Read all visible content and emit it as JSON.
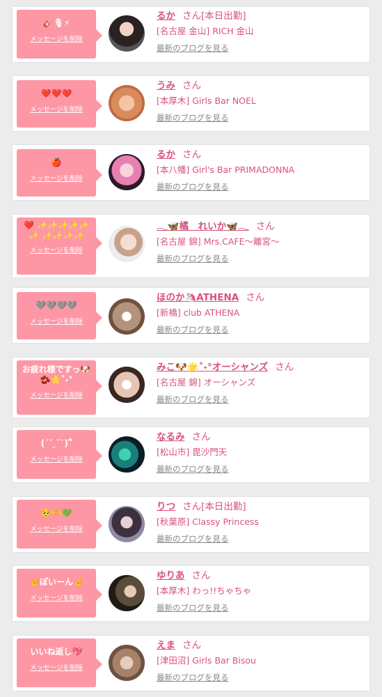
{
  "delete_label": "メッセージを削除",
  "blog_label": "最新のブログを見る",
  "honorific": "さん",
  "colors": {
    "background": "#ececec",
    "bubble": "#fe97a5",
    "accent": "#d8527b",
    "muted": "#888888"
  },
  "items": [
    {
      "message": "🎸🎙⚡",
      "name": "るか",
      "status": "[本日出勤]",
      "shop": "[名古屋 金山] RICH 金山"
    },
    {
      "message": "❤️❤️❤️",
      "name": "うみ",
      "status": "",
      "shop": "[本厚木] Girls Bar NOEL"
    },
    {
      "message": "🍎",
      "name": "るか",
      "status": "",
      "shop": "[本八幡] Girl's Bar PRIMADONNA"
    },
    {
      "message": "❤️ ✨✨✨✨✨✨ ✨✨✨✨",
      "name": "𓂃🦋橘　れいか🦋𓂃",
      "status": "",
      "shop": "[名古屋 錦] Mrs.CAFE〜離宮〜"
    },
    {
      "message": "🩶🩶🩶🩶",
      "name": "ほのか🦄ATHENA",
      "status": "",
      "shop": "[新橋] club ATHENA"
    },
    {
      "message": "お疲れ様ですっ🐶 🫘🌟˚˖°",
      "name": "みこ🐶🌟˚˖°オーシャンズ",
      "status": "",
      "shop": "[名古屋 錦] オーシャンズ"
    },
    {
      "message": "(ˊ˘ ̯˘ˋ)՞",
      "name": "なるみ",
      "status": "",
      "shop": "[松山市] 毘沙門天"
    },
    {
      "message": "🥺🫶💚",
      "name": "りつ",
      "status": "[本日出勤]",
      "shop": "[秋葉原] Classy Princess"
    },
    {
      "message": "🤘ぽいーん🤘",
      "name": "ゆりあ",
      "status": "",
      "shop": "[本厚木] わっ!!ちゃちゃ"
    },
    {
      "message": "いいね返し💖",
      "name": "えま",
      "status": "",
      "shop": "[津田沼] Girls Bar Bisou"
    }
  ]
}
